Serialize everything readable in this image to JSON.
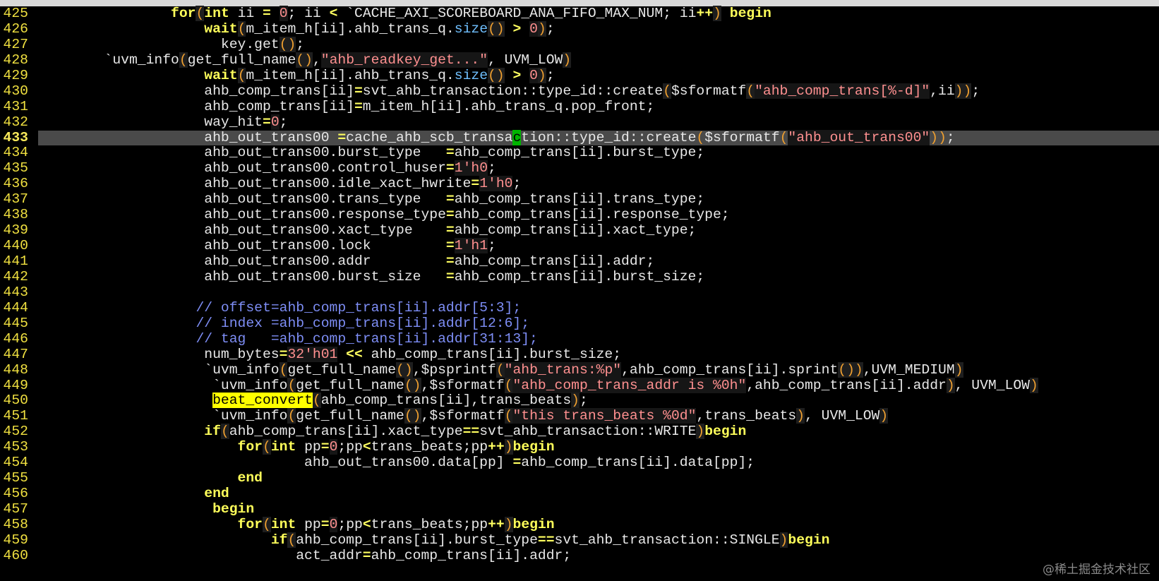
{
  "watermark": "@稀土掘金技术社区",
  "current_line": "433",
  "lines": [
    {
      "num": "425",
      "segs": [
        [
          "",
          "                "
        ],
        [
          "kw",
          "for"
        ],
        [
          "pr",
          "("
        ],
        [
          "kw",
          "int"
        ],
        [
          "",
          " ii "
        ],
        [
          "op",
          "="
        ],
        [
          "",
          " "
        ],
        [
          "num",
          "0"
        ],
        [
          "",
          "; ii "
        ],
        [
          "op",
          "<"
        ],
        [
          "",
          " `CACHE_AXI_SCOREBOARD_ANA_FIFO_MAX_NUM; ii"
        ],
        [
          "op",
          "++"
        ],
        [
          "pr",
          ")"
        ],
        [
          "",
          " "
        ],
        [
          "kw",
          "begin"
        ]
      ]
    },
    {
      "num": "426",
      "segs": [
        [
          "",
          "                    "
        ],
        [
          "kw",
          "wait"
        ],
        [
          "pr",
          "("
        ],
        [
          "",
          "m_item_h[ii].ahb_trans_q."
        ],
        [
          "mth",
          "size"
        ],
        [
          "pr",
          "()"
        ],
        [
          "",
          " "
        ],
        [
          "op",
          ">"
        ],
        [
          "",
          " "
        ],
        [
          "num",
          "0"
        ],
        [
          "pr",
          ")"
        ],
        [
          "",
          ";"
        ]
      ]
    },
    {
      "num": "427",
      "segs": [
        [
          "",
          "                      key.get"
        ],
        [
          "pr",
          "()"
        ],
        [
          "",
          ";"
        ]
      ]
    },
    {
      "num": "428",
      "segs": [
        [
          "",
          "        `uvm_info"
        ],
        [
          "pr",
          "("
        ],
        [
          "",
          "get_full_name"
        ],
        [
          "pr",
          "()"
        ],
        [
          "",
          ","
        ],
        [
          "str",
          "\"ahb_readkey_get...\""
        ],
        [
          "",
          ", UVM_LOW"
        ],
        [
          "pr",
          ")"
        ]
      ]
    },
    {
      "num": "429",
      "segs": [
        [
          "",
          "                    "
        ],
        [
          "kw",
          "wait"
        ],
        [
          "pr",
          "("
        ],
        [
          "",
          "m_item_h[ii].ahb_trans_q."
        ],
        [
          "mth",
          "size"
        ],
        [
          "pr",
          "()"
        ],
        [
          "",
          " "
        ],
        [
          "op",
          ">"
        ],
        [
          "",
          " "
        ],
        [
          "num",
          "0"
        ],
        [
          "pr",
          ")"
        ],
        [
          "",
          ";"
        ]
      ]
    },
    {
      "num": "430",
      "segs": [
        [
          "",
          "                    ahb_comp_trans[ii]"
        ],
        [
          "op",
          "="
        ],
        [
          "",
          "svt_ahb_transaction::type_id::create"
        ],
        [
          "pr",
          "("
        ],
        [
          "",
          "$sformatf"
        ],
        [
          "pr",
          "("
        ],
        [
          "str",
          "\"ahb_comp_trans[%-d]\""
        ],
        [
          "",
          ",ii"
        ],
        [
          "pr",
          "))"
        ],
        [
          "",
          ";"
        ]
      ]
    },
    {
      "num": "431",
      "segs": [
        [
          "",
          "                    ahb_comp_trans[ii]"
        ],
        [
          "op",
          "="
        ],
        [
          "",
          "m_item_h[ii].ahb_trans_q.pop_front;"
        ]
      ]
    },
    {
      "num": "432",
      "segs": [
        [
          "",
          "                    way_hit"
        ],
        [
          "op",
          "="
        ],
        [
          "num",
          "0"
        ],
        [
          "",
          ";"
        ]
      ]
    },
    {
      "num": "433",
      "segs": [
        [
          "",
          "                    ahb_out_trans00 "
        ],
        [
          "op",
          "="
        ],
        [
          "",
          "cache_ahb_scb_transa"
        ],
        [
          "cursor",
          "c"
        ],
        [
          "",
          "tion::type_id::create"
        ],
        [
          "sym",
          "("
        ],
        [
          "",
          "$sformatf"
        ],
        [
          "sym",
          "("
        ],
        [
          "str",
          "\"ahb_out_trans00\""
        ],
        [
          "sym",
          "))"
        ],
        [
          "",
          ";"
        ]
      ]
    },
    {
      "num": "434",
      "segs": [
        [
          "",
          "                    ahb_out_trans00.burst_type   "
        ],
        [
          "op",
          "="
        ],
        [
          "",
          "ahb_comp_trans[ii].burst_type;"
        ]
      ]
    },
    {
      "num": "435",
      "segs": [
        [
          "",
          "                    ahb_out_trans00.control_huser"
        ],
        [
          "op",
          "="
        ],
        [
          "num",
          "1'h0"
        ],
        [
          "",
          ";"
        ]
      ]
    },
    {
      "num": "436",
      "segs": [
        [
          "",
          "                    ahb_out_trans00.idle_xact_hwrite"
        ],
        [
          "op",
          "="
        ],
        [
          "num",
          "1'h0"
        ],
        [
          "",
          ";"
        ]
      ]
    },
    {
      "num": "437",
      "segs": [
        [
          "",
          "                    ahb_out_trans00.trans_type   "
        ],
        [
          "op",
          "="
        ],
        [
          "",
          "ahb_comp_trans[ii].trans_type;"
        ]
      ]
    },
    {
      "num": "438",
      "segs": [
        [
          "",
          "                    ahb_out_trans00.response_type"
        ],
        [
          "op",
          "="
        ],
        [
          "",
          "ahb_comp_trans[ii].response_type;"
        ]
      ]
    },
    {
      "num": "439",
      "segs": [
        [
          "",
          "                    ahb_out_trans00.xact_type    "
        ],
        [
          "op",
          "="
        ],
        [
          "",
          "ahb_comp_trans[ii].xact_type;"
        ]
      ]
    },
    {
      "num": "440",
      "segs": [
        [
          "",
          "                    ahb_out_trans00.lock         "
        ],
        [
          "op",
          "="
        ],
        [
          "num",
          "1'h1"
        ],
        [
          "",
          ";"
        ]
      ]
    },
    {
      "num": "441",
      "segs": [
        [
          "",
          "                    ahb_out_trans00.addr         "
        ],
        [
          "op",
          "="
        ],
        [
          "",
          "ahb_comp_trans[ii].addr;"
        ]
      ]
    },
    {
      "num": "442",
      "segs": [
        [
          "",
          "                    ahb_out_trans00.burst_size   "
        ],
        [
          "op",
          "="
        ],
        [
          "",
          "ahb_comp_trans[ii].burst_size;"
        ]
      ]
    },
    {
      "num": "443",
      "segs": []
    },
    {
      "num": "444",
      "segs": [
        [
          "",
          "                   "
        ],
        [
          "cm",
          "// offset=ahb_comp_trans[ii].addr[5:3];"
        ]
      ]
    },
    {
      "num": "445",
      "segs": [
        [
          "",
          "                   "
        ],
        [
          "cm",
          "// index =ahb_comp_trans[ii].addr[12:6];"
        ]
      ]
    },
    {
      "num": "446",
      "segs": [
        [
          "",
          "                   "
        ],
        [
          "cm",
          "// tag   =ahb_comp_trans[ii].addr[31:13];"
        ]
      ]
    },
    {
      "num": "447",
      "segs": [
        [
          "",
          "                    num_bytes"
        ],
        [
          "op",
          "="
        ],
        [
          "num",
          "32'h01"
        ],
        [
          "",
          " "
        ],
        [
          "op",
          "<<"
        ],
        [
          "",
          " ahb_comp_trans[ii].burst_size;"
        ]
      ]
    },
    {
      "num": "448",
      "segs": [
        [
          "",
          "                    `uvm_info"
        ],
        [
          "pr",
          "("
        ],
        [
          "",
          "get_full_name"
        ],
        [
          "pr",
          "()"
        ],
        [
          "",
          ",$psprintf"
        ],
        [
          "pr",
          "("
        ],
        [
          "str",
          "\"ahb_trans:%p\""
        ],
        [
          "",
          ",ahb_comp_trans[ii].sprint"
        ],
        [
          "pr",
          "())"
        ],
        [
          "",
          ",UVM_MEDIUM"
        ],
        [
          "pr",
          ")"
        ]
      ]
    },
    {
      "num": "449",
      "segs": [
        [
          "",
          "                     `uvm_info"
        ],
        [
          "pr",
          "("
        ],
        [
          "",
          "get_full_name"
        ],
        [
          "pr",
          "()"
        ],
        [
          "",
          ",$sformatf"
        ],
        [
          "pr",
          "("
        ],
        [
          "str",
          "\"ahb_comp_trans_addr is %0h\""
        ],
        [
          "",
          ",ahb_comp_trans[ii].addr"
        ],
        [
          "pr",
          ")"
        ],
        [
          "",
          ", UVM_LOW"
        ],
        [
          "pr",
          ")"
        ]
      ]
    },
    {
      "num": "450",
      "segs": [
        [
          "",
          "                     "
        ],
        [
          "hl",
          "beat_convert"
        ],
        [
          "pr",
          "("
        ],
        [
          "",
          "ahb_comp_trans[ii],trans_beats"
        ],
        [
          "pr",
          ")"
        ],
        [
          "",
          ";"
        ]
      ]
    },
    {
      "num": "451",
      "segs": [
        [
          "",
          "                     `uvm_info"
        ],
        [
          "pr",
          "("
        ],
        [
          "",
          "get_full_name"
        ],
        [
          "pr",
          "()"
        ],
        [
          "",
          ",$sformatf"
        ],
        [
          "pr",
          "("
        ],
        [
          "str",
          "\"this trans_beats %0d\""
        ],
        [
          "",
          ",trans_beats"
        ],
        [
          "pr",
          ")"
        ],
        [
          "",
          ", UVM_LOW"
        ],
        [
          "pr",
          ")"
        ]
      ]
    },
    {
      "num": "452",
      "segs": [
        [
          "",
          "                    "
        ],
        [
          "kw",
          "if"
        ],
        [
          "pr",
          "("
        ],
        [
          "",
          "ahb_comp_trans[ii].xact_type"
        ],
        [
          "op",
          "=="
        ],
        [
          "",
          "svt_ahb_transaction::WRITE"
        ],
        [
          "pr",
          ")"
        ],
        [
          "kw",
          "begin"
        ]
      ]
    },
    {
      "num": "453",
      "segs": [
        [
          "",
          "                        "
        ],
        [
          "kw",
          "for"
        ],
        [
          "pr",
          "("
        ],
        [
          "kw",
          "int"
        ],
        [
          "",
          " pp"
        ],
        [
          "op",
          "="
        ],
        [
          "num",
          "0"
        ],
        [
          "",
          ";pp"
        ],
        [
          "op",
          "<"
        ],
        [
          "",
          "trans_beats;pp"
        ],
        [
          "op",
          "++"
        ],
        [
          "pr",
          ")"
        ],
        [
          "kw",
          "begin"
        ]
      ]
    },
    {
      "num": "454",
      "segs": [
        [
          "",
          "                                ahb_out_trans00.data[pp] "
        ],
        [
          "op",
          "="
        ],
        [
          "",
          "ahb_comp_trans[ii].data[pp];"
        ]
      ]
    },
    {
      "num": "455",
      "segs": [
        [
          "",
          "                        "
        ],
        [
          "kw",
          "end"
        ]
      ]
    },
    {
      "num": "456",
      "segs": [
        [
          "",
          "                    "
        ],
        [
          "kw",
          "end"
        ]
      ]
    },
    {
      "num": "457",
      "segs": [
        [
          "",
          "                     "
        ],
        [
          "kw",
          "begin"
        ]
      ]
    },
    {
      "num": "458",
      "segs": [
        [
          "",
          "                        "
        ],
        [
          "kw",
          "for"
        ],
        [
          "pr",
          "("
        ],
        [
          "kw",
          "int"
        ],
        [
          "",
          " pp"
        ],
        [
          "op",
          "="
        ],
        [
          "num",
          "0"
        ],
        [
          "",
          ";pp"
        ],
        [
          "op",
          "<"
        ],
        [
          "",
          "trans_beats;pp"
        ],
        [
          "op",
          "++"
        ],
        [
          "pr",
          ")"
        ],
        [
          "kw",
          "begin"
        ]
      ]
    },
    {
      "num": "459",
      "segs": [
        [
          "",
          "                            "
        ],
        [
          "kw",
          "if"
        ],
        [
          "pr",
          "("
        ],
        [
          "",
          "ahb_comp_trans[ii].burst_type"
        ],
        [
          "op",
          "=="
        ],
        [
          "",
          "svt_ahb_transaction::SINGLE"
        ],
        [
          "pr",
          ")"
        ],
        [
          "kw",
          "begin"
        ]
      ]
    },
    {
      "num": "460",
      "segs": [
        [
          "",
          "                               act_addr"
        ],
        [
          "op",
          "="
        ],
        [
          "",
          "ahb_comp_trans[ii].addr;"
        ]
      ]
    }
  ]
}
